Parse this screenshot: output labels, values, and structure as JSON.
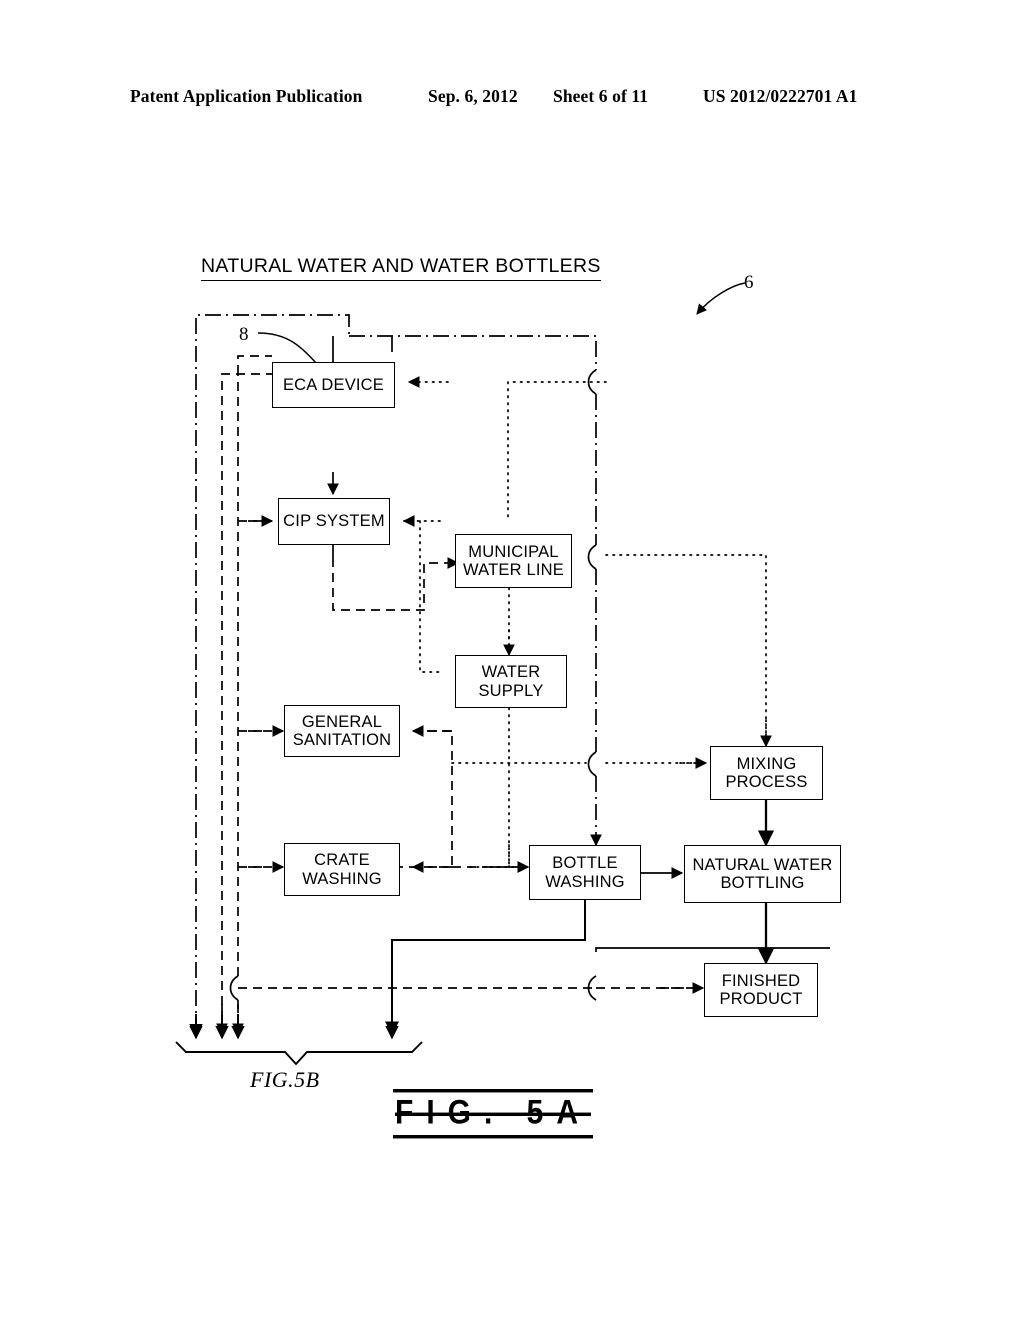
{
  "header": {
    "publication": "Patent Application Publication",
    "date": "Sep. 6, 2012",
    "sheet": "Sheet 6 of 11",
    "number": "US 2012/0222701 A1"
  },
  "figure": {
    "title": "NATURAL WATER AND WATER BOTTLERS",
    "caption_main": "FIG. 5A",
    "caption_continuation": "FIG.5B",
    "reference_numerals": {
      "system": "6",
      "eca_device": "8"
    },
    "nodes": [
      {
        "id": "eca-device",
        "label_line1": "ECA DEVICE",
        "label_line2": ""
      },
      {
        "id": "cip-system",
        "label_line1": "CIP SYSTEM",
        "label_line2": ""
      },
      {
        "id": "municipal-water-line",
        "label_line1": "MUNICIPAL",
        "label_line2": "WATER LINE"
      },
      {
        "id": "water-supply",
        "label_line1": "WATER",
        "label_line2": "SUPPLY"
      },
      {
        "id": "general-sanitation",
        "label_line1": "GENERAL",
        "label_line2": "SANITATION"
      },
      {
        "id": "crate-washing",
        "label_line1": "CRATE",
        "label_line2": "WASHING"
      },
      {
        "id": "bottle-washing",
        "label_line1": "BOTTLE",
        "label_line2": "WASHING"
      },
      {
        "id": "mixing-process",
        "label_line1": "MIXING",
        "label_line2": "PROCESS"
      },
      {
        "id": "natural-water-bottling",
        "label_line1": "NATURAL WATER",
        "label_line2": "BOTTLING"
      },
      {
        "id": "finished-product",
        "label_line1": "FINISHED",
        "label_line2": "PRODUCT"
      }
    ],
    "colors": {
      "ink": "#000000",
      "paper": "#ffffff"
    }
  }
}
